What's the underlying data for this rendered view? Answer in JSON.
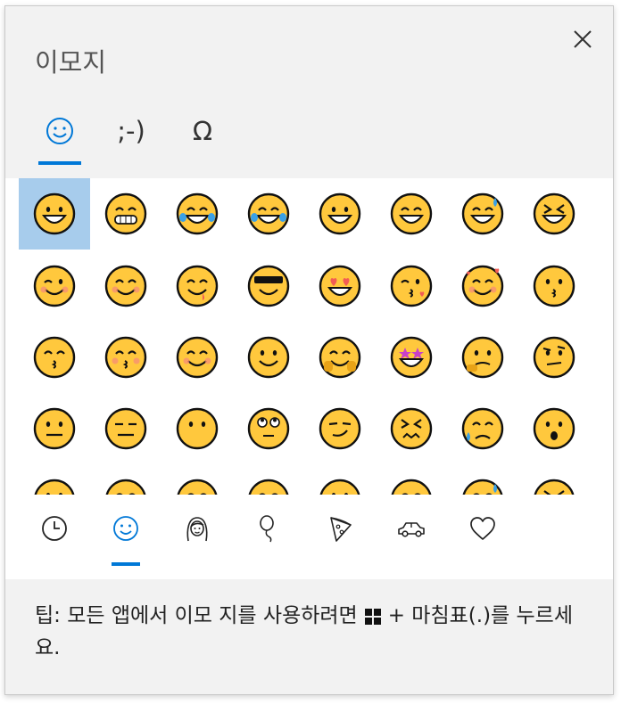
{
  "panel": {
    "title": "이모지"
  },
  "tabs": [
    {
      "label": "",
      "icon": "smiley-icon",
      "active": true
    },
    {
      "label": ";-)",
      "icon": "kaomoji",
      "active": false
    },
    {
      "label": "Ω",
      "icon": "symbols",
      "active": false
    }
  ],
  "emoji_grid": [
    [
      "grinning-face",
      "beaming-face",
      "face-with-tears-of-joy",
      "rolling-on-floor-laughing",
      "grinning-face-big-eyes",
      "grinning-squinting-face",
      "grinning-face-sweat",
      "squinting-face"
    ],
    [
      "winking-face",
      "smiling-face-smiling-eyes",
      "face-savoring-food",
      "smiling-face-sunglasses",
      "smiling-face-heart-eyes",
      "face-blowing-kiss",
      "smiling-face-with-hearts",
      "kissing-face"
    ],
    [
      "kissing-face-smiling-eyes",
      "kissing-face-closed-eyes",
      "smiling-face",
      "slightly-smiling-face",
      "hugging-face",
      "star-struck",
      "thinking-face",
      "face-raised-eyebrow"
    ],
    [
      "neutral-face",
      "expressionless-face",
      "face-without-mouth",
      "face-rolling-eyes",
      "smirking-face",
      "persevering-face",
      "sad-relieved-face",
      "hushed-face"
    ]
  ],
  "categories": [
    {
      "icon": "clock-icon",
      "active": false
    },
    {
      "icon": "smiley-icon",
      "active": true
    },
    {
      "icon": "person-icon",
      "active": false
    },
    {
      "icon": "balloon-icon",
      "active": false
    },
    {
      "icon": "pizza-icon",
      "active": false
    },
    {
      "icon": "car-icon",
      "active": false
    },
    {
      "icon": "heart-icon",
      "active": false
    }
  ],
  "tip": {
    "prefix": "팁: 모든 앱에서 이모 지를 사용하려면",
    "suffix": "+ 마침표(.)를 누르세요."
  },
  "colors": {
    "accent": "#0078d7",
    "emoji_yellow": "#ffc83d",
    "selected_bg": "#a7ccec"
  }
}
